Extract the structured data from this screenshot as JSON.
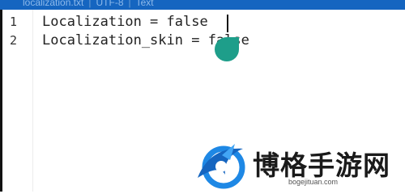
{
  "header": {
    "filename": "localization.txt",
    "encoding": "UTF-8",
    "filetype": "Text"
  },
  "editor": {
    "lines": [
      {
        "number": "1",
        "text": "Localization = false"
      },
      {
        "number": "2",
        "text": "Localization_skin = false"
      }
    ]
  },
  "watermark": {
    "title": "博格手游网",
    "url": "bogejituan.com"
  },
  "colors": {
    "header_bg": "#1565c0",
    "caret_handle": "#1e9e8a",
    "logo_blue": "#1e88e5"
  },
  "icons": {
    "caret_handle": "teardrop-handle-icon",
    "logo": "unicorn-logo-icon"
  }
}
